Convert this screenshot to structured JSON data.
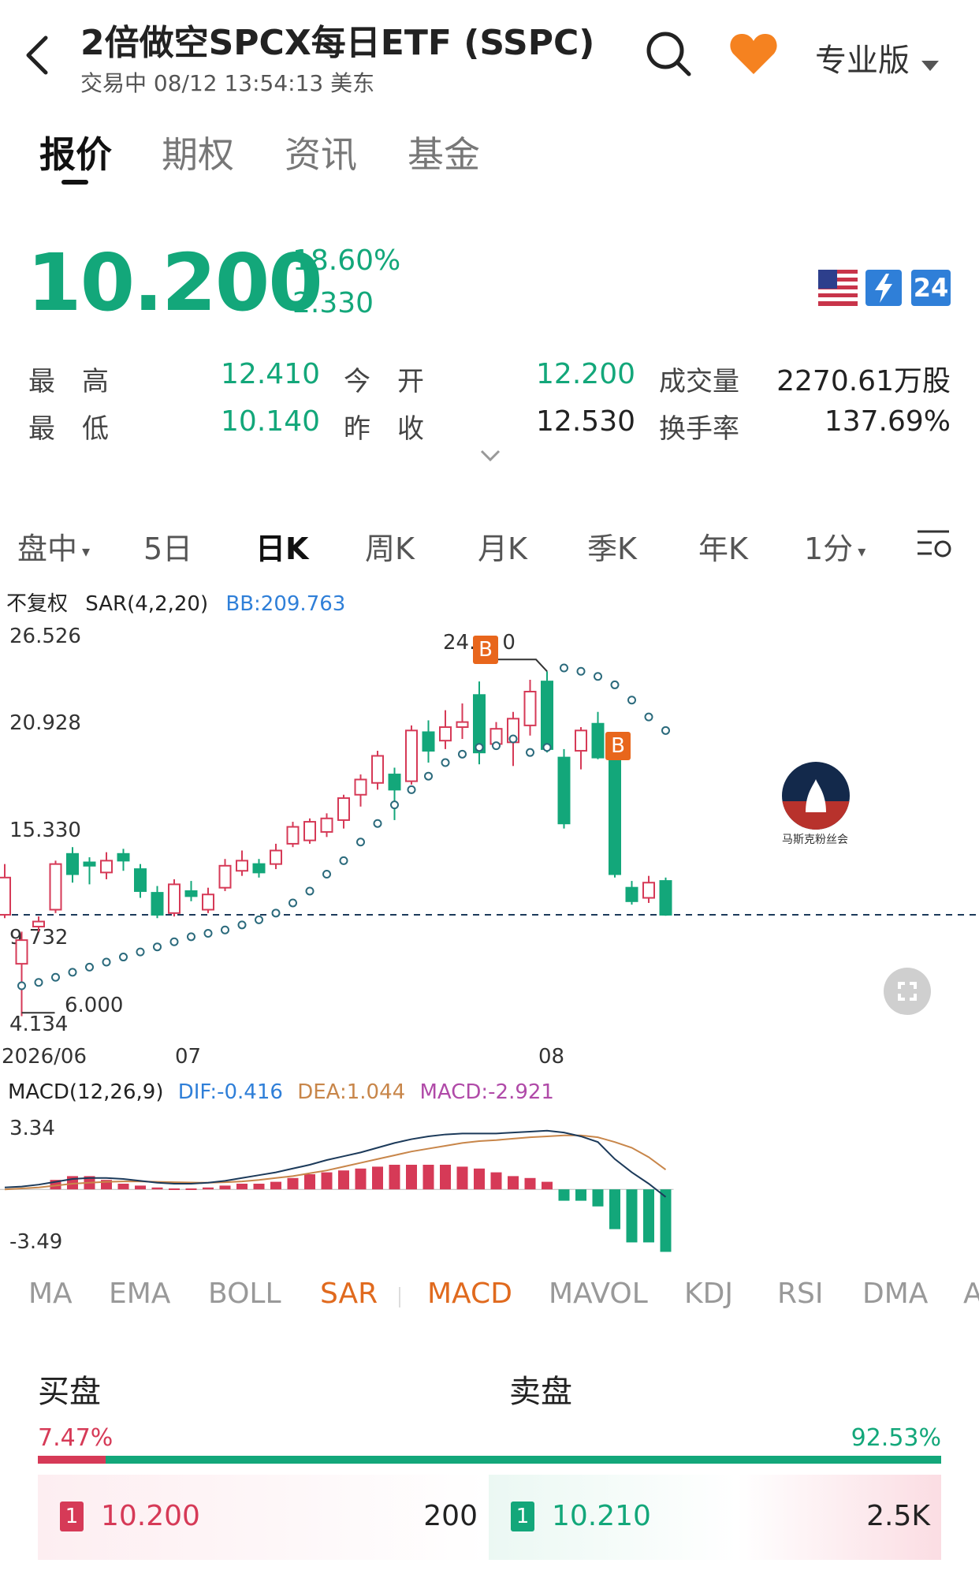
{
  "header": {
    "title": "2倍做空SPCX每日ETF (SSPC)",
    "subtitle": "交易中 08/12 13:54:13  美东",
    "pro_label": "专业版"
  },
  "tabs": [
    "报价",
    "期权",
    "资讯",
    "基金"
  ],
  "quote": {
    "price": "10.200",
    "change_pct": "-18.60%",
    "change": "-2.330",
    "badge_24": "24"
  },
  "stats": {
    "high_label": "最　高",
    "high": "12.410",
    "low_label": "最　低",
    "low": "10.140",
    "open_label": "今　开",
    "open": "12.200",
    "prev_close_label": "昨　收",
    "prev_close": "12.530",
    "volume_label": "成交量",
    "volume": "2270.61万股",
    "turnover_label": "换手率",
    "turnover": "137.69%"
  },
  "periods": [
    "盘中",
    "5日",
    "日K",
    "周K",
    "月K",
    "季K",
    "年K",
    "1分"
  ],
  "chart_header": {
    "adjust": "不复权",
    "sar": "SAR(4,2,20)",
    "bb": "BB:209.763"
  },
  "chart_labels": {
    "y_ticks": [
      "26.526",
      "20.928",
      "15.330",
      "9.732",
      "4.134"
    ],
    "x_ticks": [
      "2026/06",
      "07",
      "08"
    ],
    "marker_high": "24.",
    "marker_high_tail": "0",
    "marker_low": "6.000",
    "buy_marker": "B"
  },
  "chart_data": {
    "type": "candlestick",
    "y_range": [
      4.134,
      26.526
    ],
    "last_price_line": 10.2,
    "candles": [
      {
        "o": 10.2,
        "c": 12.4,
        "h": 13.2,
        "l": 10.0
      },
      {
        "o": 7.3,
        "c": 8.7,
        "h": 9.2,
        "l": 4.2
      },
      {
        "o": 9.5,
        "c": 9.8,
        "h": 10.1,
        "l": 9.2
      },
      {
        "o": 10.5,
        "c": 13.2,
        "h": 13.4,
        "l": 10.3
      },
      {
        "o": 13.8,
        "c": 12.6,
        "h": 14.2,
        "l": 12.1
      },
      {
        "o": 13.3,
        "c": 13.1,
        "h": 13.6,
        "l": 12.0
      },
      {
        "o": 12.7,
        "c": 13.4,
        "h": 13.9,
        "l": 12.3
      },
      {
        "o": 13.8,
        "c": 13.4,
        "h": 14.1,
        "l": 12.8
      },
      {
        "o": 12.9,
        "c": 11.6,
        "h": 13.2,
        "l": 11.2
      },
      {
        "o": 11.5,
        "c": 10.2,
        "h": 11.9,
        "l": 10.0
      },
      {
        "o": 10.3,
        "c": 12.0,
        "h": 12.3,
        "l": 10.1
      },
      {
        "o": 11.6,
        "c": 11.3,
        "h": 12.2,
        "l": 11.0
      },
      {
        "o": 10.5,
        "c": 11.4,
        "h": 11.8,
        "l": 10.3
      },
      {
        "o": 11.8,
        "c": 13.1,
        "h": 13.5,
        "l": 11.6
      },
      {
        "o": 12.8,
        "c": 13.4,
        "h": 14.0,
        "l": 12.5
      },
      {
        "o": 13.2,
        "c": 12.7,
        "h": 13.5,
        "l": 12.4
      },
      {
        "o": 13.2,
        "c": 14.0,
        "h": 14.4,
        "l": 12.9
      },
      {
        "o": 14.4,
        "c": 15.4,
        "h": 15.7,
        "l": 14.2
      },
      {
        "o": 14.6,
        "c": 15.7,
        "h": 15.9,
        "l": 14.4
      },
      {
        "o": 15.1,
        "c": 15.9,
        "h": 16.2,
        "l": 14.8
      },
      {
        "o": 15.8,
        "c": 17.1,
        "h": 17.3,
        "l": 15.3
      },
      {
        "o": 17.3,
        "c": 18.2,
        "h": 18.5,
        "l": 16.6
      },
      {
        "o": 18.0,
        "c": 19.6,
        "h": 19.9,
        "l": 17.6
      },
      {
        "o": 18.5,
        "c": 17.6,
        "h": 18.9,
        "l": 15.8
      },
      {
        "o": 18.1,
        "c": 21.1,
        "h": 21.4,
        "l": 17.9
      },
      {
        "o": 21.0,
        "c": 19.9,
        "h": 21.7,
        "l": 19.2
      },
      {
        "o": 20.5,
        "c": 21.3,
        "h": 22.3,
        "l": 20.0
      },
      {
        "o": 21.3,
        "c": 21.6,
        "h": 22.7,
        "l": 20.6
      },
      {
        "o": 23.2,
        "c": 19.8,
        "h": 24.0,
        "l": 19.1
      },
      {
        "o": 20.3,
        "c": 21.2,
        "h": 21.6,
        "l": 20.0
      },
      {
        "o": 20.4,
        "c": 21.8,
        "h": 22.2,
        "l": 19.0
      },
      {
        "o": 21.4,
        "c": 23.4,
        "h": 24.1,
        "l": 20.8
      },
      {
        "o": 24.0,
        "c": 20.0,
        "h": 24.6,
        "l": 19.8
      },
      {
        "o": 19.5,
        "c": 15.6,
        "h": 20.0,
        "l": 15.3
      },
      {
        "o": 19.9,
        "c": 21.1,
        "h": 21.3,
        "l": 18.8
      },
      {
        "o": 21.5,
        "c": 19.5,
        "h": 22.2,
        "l": 19.4
      },
      {
        "o": 19.3,
        "c": 12.6,
        "h": 19.8,
        "l": 12.4
      },
      {
        "o": 11.8,
        "c": 11.0,
        "h": 12.2,
        "l": 10.8
      },
      {
        "o": 11.2,
        "c": 12.1,
        "h": 12.5,
        "l": 10.9
      },
      {
        "o": 12.2,
        "c": 10.2,
        "h": 12.4,
        "l": 10.14
      }
    ],
    "sar": [
      null,
      6.0,
      6.2,
      6.5,
      6.8,
      7.1,
      7.4,
      7.7,
      8.0,
      8.3,
      8.6,
      8.9,
      9.1,
      9.3,
      9.6,
      9.9,
      10.3,
      10.9,
      11.6,
      12.6,
      13.4,
      14.5,
      15.6,
      16.7,
      17.6,
      18.4,
      19.2,
      19.7,
      20.1,
      20.2,
      20.6,
      19.8,
      20.1,
      24.8,
      24.6,
      24.3,
      23.8,
      22.9,
      21.9,
      21.1
    ],
    "buy_markers_index": [
      28,
      36
    ]
  },
  "macd": {
    "label": "MACD(12,26,9)",
    "dif": "DIF:-0.416",
    "dea": "DEA:1.044",
    "macd": "MACD:-2.921",
    "y_top": "3.34",
    "y_bottom": "-3.49",
    "range": [
      -3.49,
      3.34
    ],
    "hist": [
      0,
      0,
      0,
      0.5,
      0.7,
      0.7,
      0.5,
      0.3,
      0.2,
      0.1,
      0.05,
      0.05,
      0.1,
      0.2,
      0.3,
      0.3,
      0.4,
      0.6,
      0.8,
      0.9,
      1.0,
      1.1,
      1.2,
      1.3,
      1.3,
      1.3,
      1.3,
      1.2,
      1.1,
      0.9,
      0.7,
      0.6,
      0.4,
      -0.6,
      -0.6,
      -0.9,
      -2.1,
      -2.8,
      -2.8,
      -3.3
    ],
    "dif_line": [
      0.1,
      0.15,
      0.25,
      0.4,
      0.55,
      0.6,
      0.6,
      0.55,
      0.45,
      0.35,
      0.3,
      0.3,
      0.35,
      0.45,
      0.6,
      0.75,
      0.9,
      1.1,
      1.3,
      1.55,
      1.75,
      1.95,
      2.2,
      2.45,
      2.65,
      2.8,
      2.9,
      2.95,
      2.95,
      2.95,
      3.0,
      3.05,
      3.1,
      3.0,
      2.8,
      2.5,
      1.6,
      0.9,
      0.3,
      -0.4
    ],
    "dea_line": [
      0.0,
      0.05,
      0.1,
      0.2,
      0.3,
      0.35,
      0.4,
      0.42,
      0.42,
      0.4,
      0.38,
      0.36,
      0.35,
      0.38,
      0.42,
      0.5,
      0.6,
      0.7,
      0.85,
      1.0,
      1.2,
      1.4,
      1.6,
      1.8,
      2.0,
      2.15,
      2.3,
      2.45,
      2.55,
      2.6,
      2.68,
      2.75,
      2.8,
      2.85,
      2.85,
      2.75,
      2.5,
      2.2,
      1.7,
      1.04
    ]
  },
  "indicators": [
    "MA",
    "EMA",
    "BOLL",
    "SAR",
    "MACD",
    "MAVOL",
    "KDJ",
    "RSI",
    "DMA",
    "A"
  ],
  "active_indicators": [
    "SAR",
    "MACD"
  ],
  "orderbook": {
    "buy_label": "买盘",
    "sell_label": "卖盘",
    "buy_pct": "7.47%",
    "sell_pct": "92.53%",
    "buy_fraction": 0.0747,
    "bid_level": "1",
    "bid_price": "10.200",
    "bid_size": "200",
    "ask_level": "1",
    "ask_price": "10.210",
    "ask_size": "2.5K"
  },
  "watermark": "马斯克粉丝会",
  "colors": {
    "up": "#d63a57",
    "down": "#13a77a",
    "accent": "#e06a1e",
    "blue": "#2f7fd8",
    "sar": "#2b6a7c"
  }
}
